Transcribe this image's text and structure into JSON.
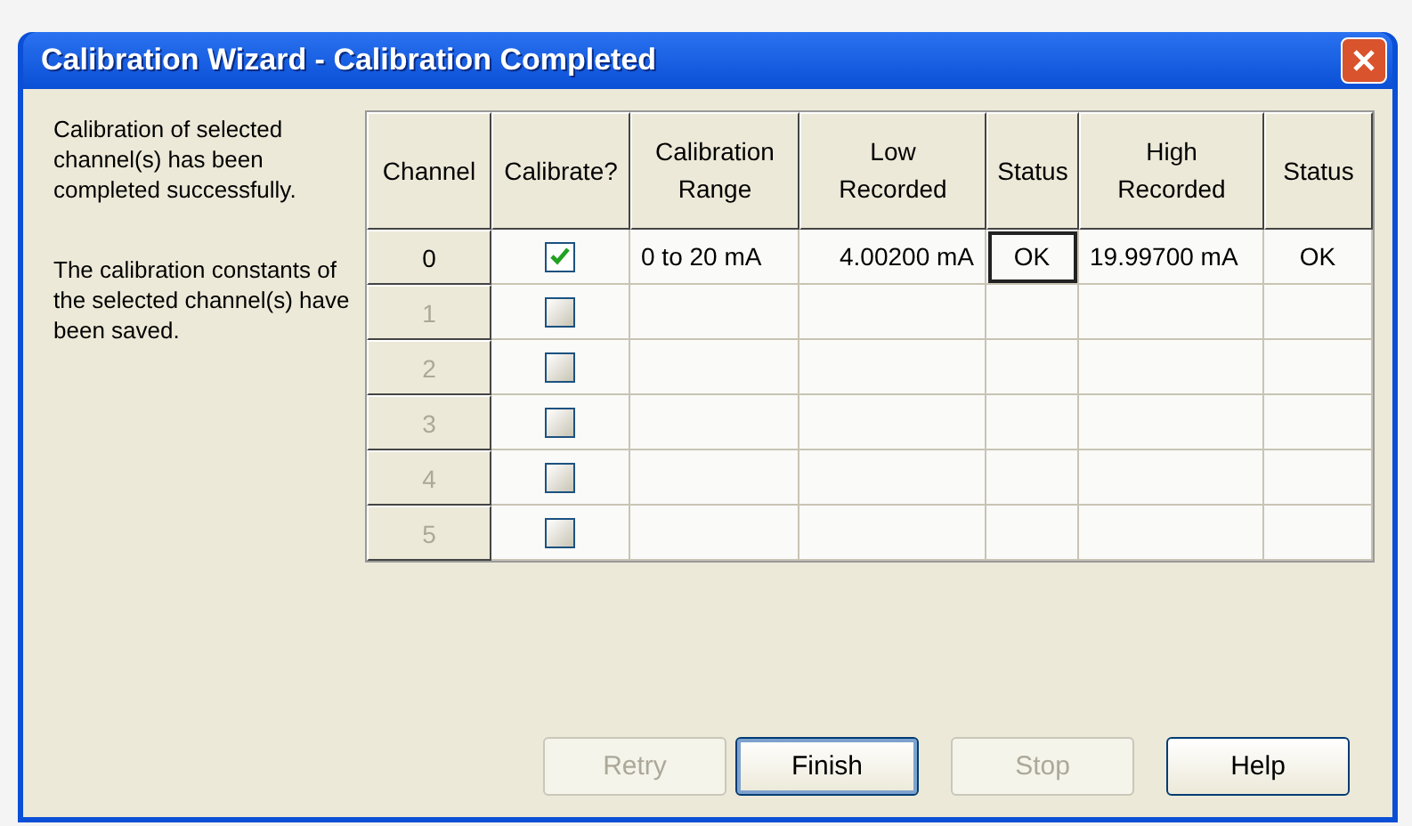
{
  "window": {
    "title": "Calibration Wizard - Calibration Completed"
  },
  "messages": [
    "Calibration of selected channel(s) has been completed successfully.",
    "The calibration constants of the selected channel(s) have been saved."
  ],
  "table": {
    "columns": [
      "Channel",
      "Calibrate?",
      "Calibration Range",
      "Low Recorded",
      "Status",
      "High Recorded",
      "Status"
    ],
    "rows": [
      {
        "channel": "0",
        "enabled": true,
        "checked": true,
        "range": "0 to 20 mA",
        "low": "4.00200 mA",
        "low_status": "OK",
        "low_status_focused": true,
        "high": "19.99700 mA",
        "high_status": "OK"
      },
      {
        "channel": "1",
        "enabled": false,
        "checked": false
      },
      {
        "channel": "2",
        "enabled": false,
        "checked": false
      },
      {
        "channel": "3",
        "enabled": false,
        "checked": false
      },
      {
        "channel": "4",
        "enabled": false,
        "checked": false
      },
      {
        "channel": "5",
        "enabled": false,
        "checked": false
      }
    ]
  },
  "buttons": [
    {
      "label": "Retry",
      "disabled": true,
      "default": false
    },
    {
      "label": "Finish",
      "disabled": false,
      "default": true
    },
    {
      "label": "Stop",
      "disabled": true,
      "default": false
    },
    {
      "label": "Help",
      "disabled": false,
      "default": false
    }
  ]
}
